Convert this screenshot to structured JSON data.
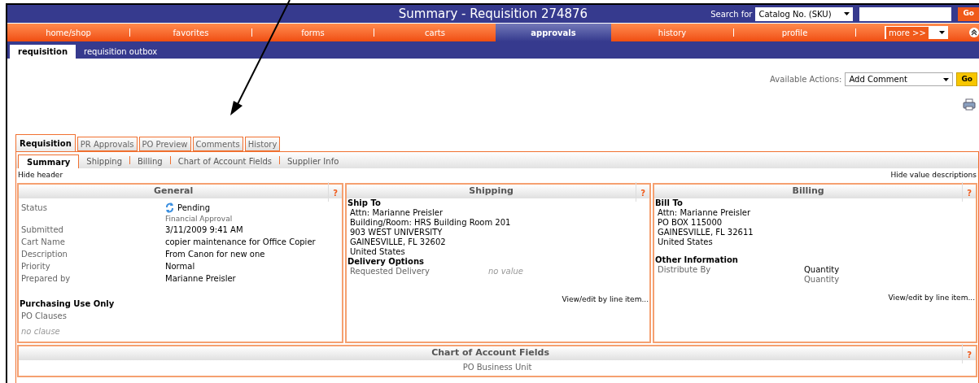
{
  "title": "Summary - Requisition 274876",
  "search": {
    "label": "Search for",
    "select_value": "Catalog No. (SKU)",
    "button": "Go"
  },
  "nav": [
    {
      "label": "home/shop",
      "selected": false
    },
    {
      "label": "favorites",
      "selected": false
    },
    {
      "label": "forms",
      "selected": false
    },
    {
      "label": "carts",
      "selected": false
    },
    {
      "label": "approvals",
      "selected": true
    },
    {
      "label": "history",
      "selected": false
    },
    {
      "label": "profile",
      "selected": false
    }
  ],
  "more_select": "more >>",
  "subnav": [
    {
      "label": "requisition",
      "selected": true
    },
    {
      "label": "requisition outbox",
      "selected": false
    }
  ],
  "actions": {
    "label": "Available Actions:",
    "value": "Add Comment",
    "button": "Go"
  },
  "doc_tabs": [
    {
      "label": "Requisition",
      "selected": true
    },
    {
      "label": "PR Approvals",
      "selected": false
    },
    {
      "label": "PO Preview",
      "selected": false
    },
    {
      "label": "Comments",
      "selected": false
    },
    {
      "label": "History",
      "selected": false
    }
  ],
  "section_tabs": [
    {
      "label": "Summary",
      "selected": true
    },
    {
      "label": "Shipping",
      "selected": false
    },
    {
      "label": "Billing",
      "selected": false
    },
    {
      "label": "Chart of Account Fields",
      "selected": false
    },
    {
      "label": "Supplier Info",
      "selected": false
    }
  ],
  "hide_header": "Hide header",
  "hide_value_descriptions": "Hide value descriptions",
  "general": {
    "title": "General",
    "help": "?",
    "fields": [
      {
        "label": "Status",
        "value": "Pending",
        "note": "Financial Approval"
      },
      {
        "label": "Submitted",
        "value": "3/11/2009 9:41 AM"
      },
      {
        "label": "Cart Name",
        "value": "copier maintenance for Office Copier"
      },
      {
        "label": "Description",
        "value": "From Canon for new one"
      },
      {
        "label": "Priority",
        "value": "Normal"
      },
      {
        "label": "Prepared by",
        "value": "Marianne Preisler"
      }
    ],
    "purchasing_heading": "Purchasing Use Only",
    "po_clauses": "PO Clauses",
    "no_clause": "no clause"
  },
  "shipping": {
    "title": "Shipping",
    "help": "?",
    "heading": "Ship To",
    "address": [
      "Attn: Marianne Preisler",
      "Building/Room: HRS Building Room 201",
      "903 WEST UNIVERSITY",
      "GAINESVILLE, FL 32602",
      "United States"
    ],
    "options_heading": "Delivery Options",
    "field_label": "Requested Delivery",
    "field_value": "no value",
    "link": "View/edit by line item..."
  },
  "billing": {
    "title": "Billing",
    "help": "?",
    "heading": "Bill To",
    "address": [
      "Attn: Marianne Preisler",
      "PO BOX 115000",
      "GAINESVILLE, FL 32611",
      "United States"
    ],
    "options_heading": "Other Information",
    "field_label": "Distribute By",
    "field_value": "Quantity",
    "field_note": "Quantity",
    "link": "View/edit by line item..."
  },
  "chart_fields": {
    "title": "Chart of Account Fields",
    "help": "?",
    "first_label": "PO Business Unit"
  }
}
